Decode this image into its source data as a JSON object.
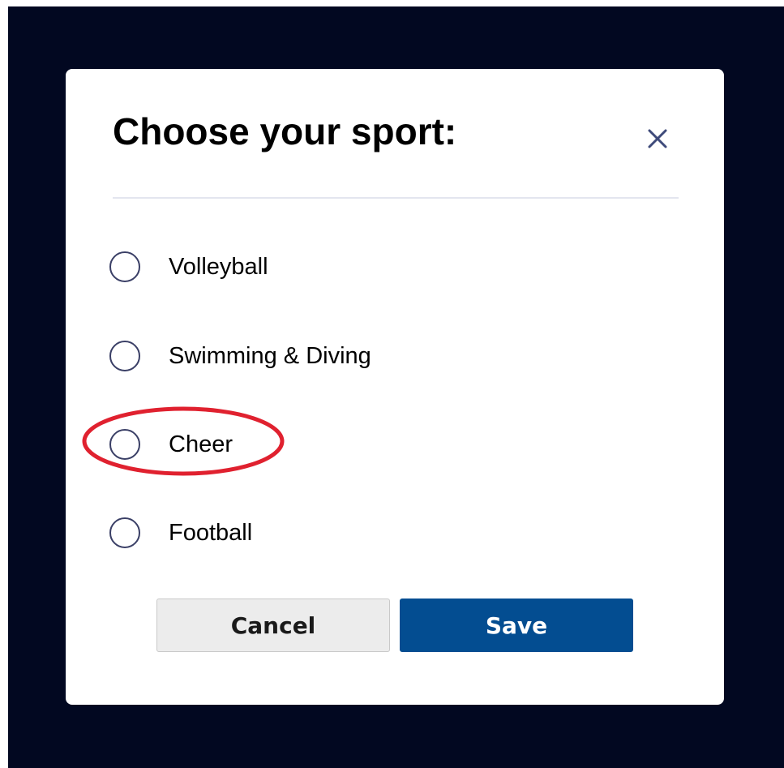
{
  "modal": {
    "title": "Choose your sport:",
    "close_icon": "close-icon"
  },
  "options": [
    {
      "label": "Volleyball",
      "selected": false
    },
    {
      "label": "Swimming & Diving",
      "selected": false
    },
    {
      "label": "Cheer",
      "selected": false,
      "annotated": true
    },
    {
      "label": "Football",
      "selected": false
    }
  ],
  "buttons": {
    "cancel_label": "Cancel",
    "save_label": "Save"
  },
  "colors": {
    "backdrop": "#020821",
    "primary": "#034d91",
    "annotation": "#e0212f"
  }
}
